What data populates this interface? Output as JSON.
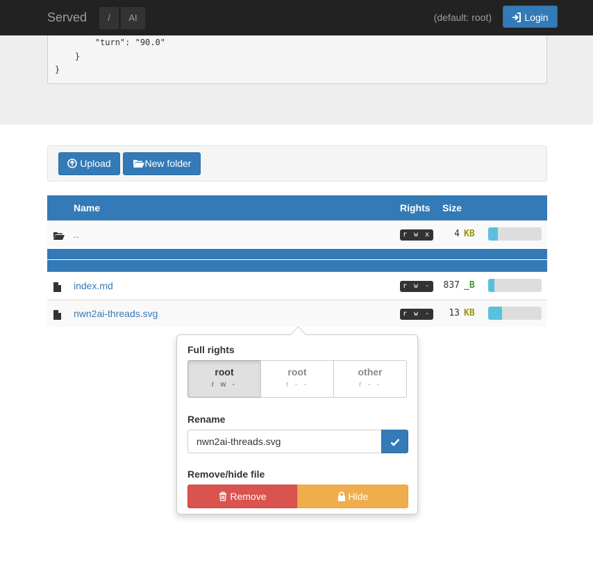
{
  "navbar": {
    "brand": "Served",
    "crumbs": [
      "/",
      "AI"
    ],
    "default_user": "(default: root)",
    "login_label": "Login"
  },
  "code": {
    "lines": [
      "        \"turn\": \"90.0\"",
      "    }",
      "}"
    ]
  },
  "toolbar": {
    "upload_label": "Upload",
    "new_folder_label": "New folder"
  },
  "table": {
    "headers": {
      "name": "Name",
      "rights": "Rights",
      "size": "Size"
    },
    "rows": [
      {
        "name": "..",
        "rights": "rwx",
        "size": "4",
        "unit": "KB",
        "unit_color": "#999900",
        "usage": 0.18,
        "icon": "folder-open-icon"
      },
      {
        "name": "index.md",
        "rights": "rw-",
        "size": "837",
        "unit": "_B",
        "unit_color": "#3c9a2e",
        "usage": 0.12,
        "icon": "file-icon"
      },
      {
        "name": "nwn2ai-threads.svg",
        "rights": "rw-",
        "size": "13",
        "unit": "KB",
        "unit_color": "#999900",
        "usage": 0.26,
        "icon": "file-icon"
      }
    ]
  },
  "popover": {
    "rights_title": "Full rights",
    "rights": [
      {
        "name": "root",
        "perm": "rw-",
        "active": true
      },
      {
        "name": "root",
        "perm": "r--",
        "active": false
      },
      {
        "name": "other",
        "perm": "r--",
        "active": false
      }
    ],
    "rename_title": "Rename",
    "rename_value": "nwn2ai-threads.svg",
    "remove_title": "Remove/hide file",
    "remove_label": "Remove",
    "hide_label": "Hide"
  },
  "colors": {
    "primary": "#337ab7",
    "danger": "#d9534f",
    "warning": "#f0ad4e",
    "navbar": "#222222"
  }
}
